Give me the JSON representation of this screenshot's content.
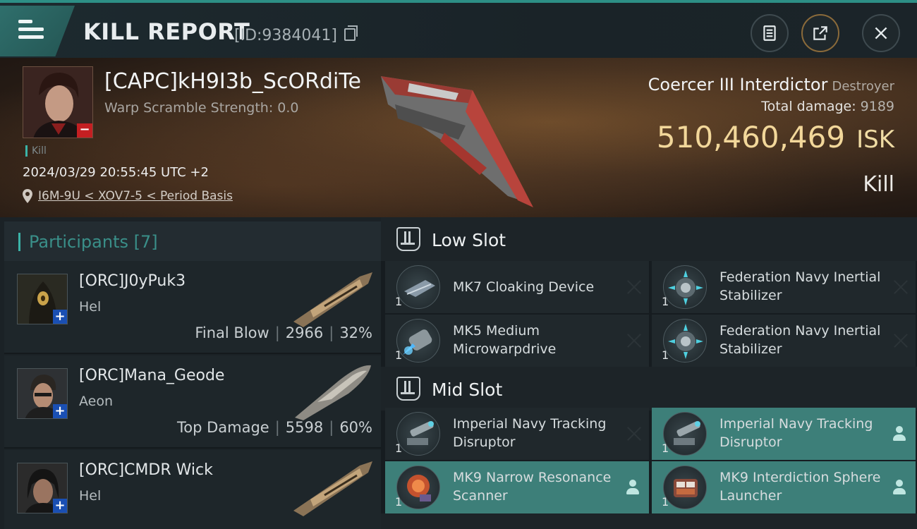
{
  "header": {
    "title": "KILL REPORT",
    "report_id": "[ID:9384041]"
  },
  "victim": {
    "name": "[CAPC]kH9I3b_ScORdiTe",
    "warp_scramble": "Warp Scramble Strength: 0.0",
    "tag": "Kill",
    "datetime": "2024/03/29 20:55:45 UTC +2",
    "location": "I6M-9U < XOV7-5 < Period Basis",
    "ship_name": "Coercer III Interdictor",
    "ship_class": "Destroyer",
    "total_damage_label": "Total damage:",
    "total_damage": "9189",
    "isk_value": "510,460,469",
    "isk_unit": "ISK",
    "result": "Kill"
  },
  "participants": {
    "title": "Participants [7]",
    "items": [
      {
        "name": "[ORC]J0yPuk3",
        "ship": "Hel",
        "role": "Final Blow",
        "damage": "2966",
        "percent": "32%"
      },
      {
        "name": "[ORC]Mana_Geode",
        "ship": "Aeon",
        "role": "Top Damage",
        "damage": "5598",
        "percent": "60%"
      },
      {
        "name": "[ORC]CMDR Wick",
        "ship": "Hel"
      }
    ]
  },
  "fitting": {
    "low_slot": {
      "label": "Low Slot",
      "modules": [
        {
          "name": "MK7 Cloaking Device",
          "qty": "1"
        },
        {
          "name": "Federation Navy Inertial Stabilizer",
          "qty": "1"
        },
        {
          "name": "MK5 Medium Microwarpdrive",
          "qty": "1"
        },
        {
          "name": "Federation Navy Inertial Stabilizer",
          "qty": "1"
        }
      ]
    },
    "mid_slot": {
      "label": "Mid Slot",
      "modules": [
        {
          "name": "Imperial Navy Tracking Disruptor",
          "qty": "1"
        },
        {
          "name": "Imperial Navy Tracking Disruptor",
          "qty": "1"
        },
        {
          "name": "MK9 Narrow Resonance Scanner",
          "qty": "1"
        },
        {
          "name": "MK9 Interdiction Sphere Launcher",
          "qty": "1"
        }
      ]
    }
  },
  "colors": {
    "accent": "#3bb3a8",
    "isk": "#f2d79a",
    "dropped_highlight": "#3d7f79",
    "victim_badge": "#c41f22",
    "participant_badge": "#1a4fb3"
  },
  "icons": [
    "menu-icon",
    "copy-icon",
    "clipboard-icon",
    "share-icon",
    "close-icon",
    "location-pin-icon",
    "slot-icon",
    "destroyed-x-icon",
    "dropped-person-icon"
  ]
}
